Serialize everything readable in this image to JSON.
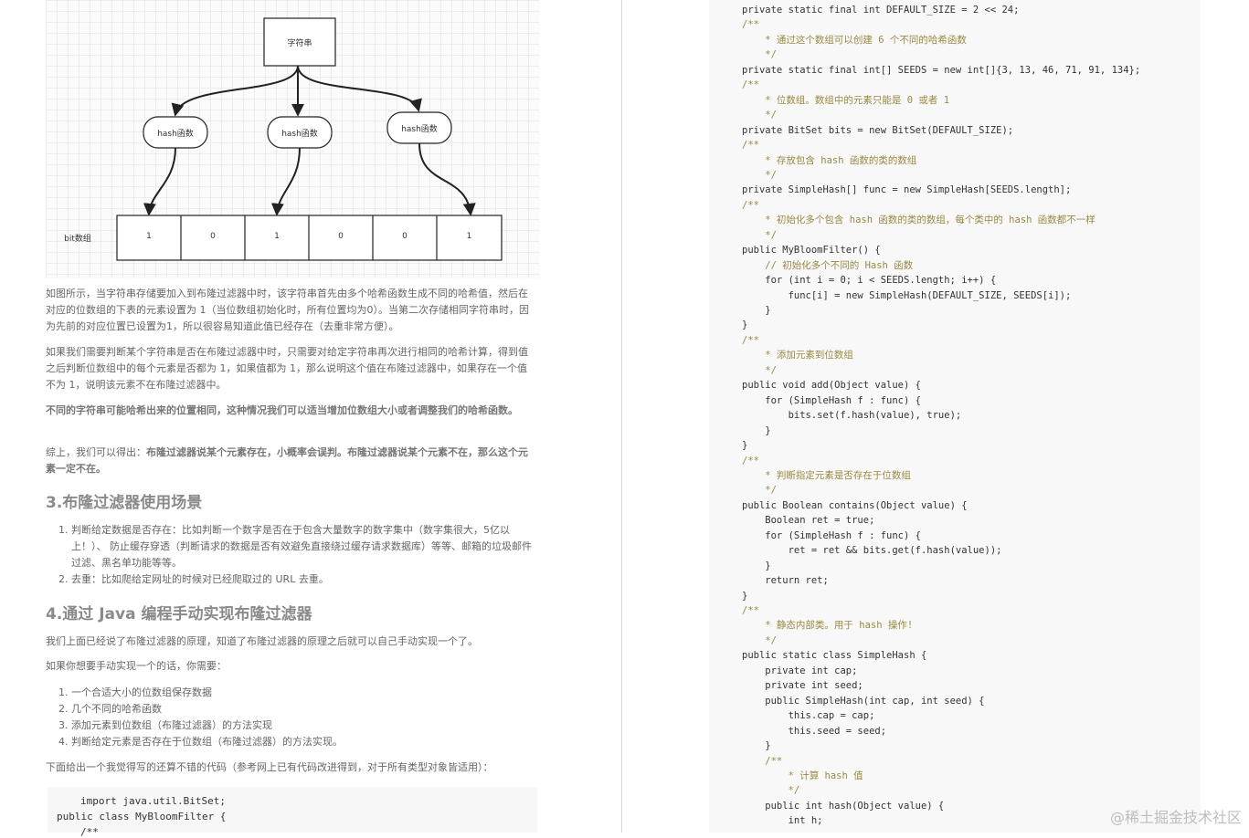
{
  "diagram": {
    "top_box": "字符串",
    "hash_nodes": [
      "hash函数",
      "hash函数",
      "hash函数"
    ],
    "array_label": "bit数组",
    "array_values": [
      "1",
      "0",
      "1",
      "0",
      "0",
      "1"
    ]
  },
  "article": {
    "p1": "如图所示，当字符串存储要加入到布隆过滤器中时，该字符串首先由多个哈希函数生成不同的哈希值，然后在对应的位数组的下表的元素设置为 1（当位数组初始化时，所有位置均为0）。当第二次存储相同字符串时，因为先前的对应位置已设置为1，所以很容易知道此值已经存在（去重非常方便）。",
    "p2": "如果我们需要判断某个字符串是否在布隆过滤器中时，只需要对给定字符串再次进行相同的哈希计算，得到值之后判断位数组中的每个元素是否都为 1，如果值都为 1，那么说明这个值在布隆过滤器中，如果存在一个值不为 1，说明该元素不在布隆过滤器中。",
    "p3_bold": "不同的字符串可能哈希出来的位置相同，这种情况我们可以适当增加位数组大小或者调整我们的哈希函数。",
    "p4_prefix": "综上，我们可以得出：",
    "p4_bold": "布隆过滤器说某个元素存在，小概率会误判。布隆过滤器说某个元素不在，那么这个元素一定不在。",
    "h3_1": "3.布隆过滤器使用场景",
    "list1": [
      {
        "num": "1.",
        "text": "判断给定数据是否存在：比如判断一个数字是否在于包含大量数字的数字集中（数字集很大，5亿以上！）、 防止缓存穿透（判断请求的数据是否有效避免直接绕过缓存请求数据库）等等、邮箱的垃圾邮件过滤、黑名单功能等等。"
      },
      {
        "num": "2.",
        "text": "去重：比如爬给定网址的时候对已经爬取过的 URL 去重。"
      }
    ],
    "h3_2": "4.通过 Java 编程手动实现布隆过滤器",
    "p5": "我们上面已经说了布隆过滤器的原理，知道了布隆过滤器的原理之后就可以自己手动实现一个了。",
    "p6": "如果你想要手动实现一个的话，你需要：",
    "list2": [
      {
        "num": "1.",
        "text": "一个合适大小的位数组保存数据"
      },
      {
        "num": "2.",
        "text": "几个不同的哈希函数"
      },
      {
        "num": "3.",
        "text": "添加元素到位数组（布隆过滤器）的方法实现"
      },
      {
        "num": "4.",
        "text": "判断给定元素是否存在于位数组（布隆过滤器）的方法实现。"
      }
    ],
    "p7": "下面给出一个我觉得写的还算不错的代码（参考网上已有代码改进得到，对于所有类型对象皆适用）：",
    "code_l1": "import java.util.BitSet;",
    "code_l2": "public class MyBloomFilter {",
    "code_l3": "/**"
  },
  "code": [
    "private static final int DEFAULT_SIZE = 2 << 24;",
    "/**",
    "    * 通过这个数组可以创建 6 个不同的哈希函数",
    "    */",
    "private static final int[] SEEDS = new int[]{3, 13, 46, 71, 91, 134};",
    "/**",
    "    * 位数组。数组中的元素只能是 0 或者 1",
    "    */",
    "private BitSet bits = new BitSet(DEFAULT_SIZE);",
    "/**",
    "    * 存放包含 hash 函数的类的数组",
    "    */",
    "private SimpleHash[] func = new SimpleHash[SEEDS.length];",
    "/**",
    "    * 初始化多个包含 hash 函数的类的数组，每个类中的 hash 函数都不一样",
    "    */",
    "public MyBloomFilter() {",
    "    // 初始化多个不同的 Hash 函数",
    "    for (int i = 0; i < SEEDS.length; i++) {",
    "        func[i] = new SimpleHash(DEFAULT_SIZE, SEEDS[i]);",
    "    }",
    "}",
    "/**",
    "    * 添加元素到位数组",
    "    */",
    "public void add(Object value) {",
    "    for (SimpleHash f : func) {",
    "        bits.set(f.hash(value), true);",
    "    }",
    "}",
    "/**",
    "    * 判断指定元素是否存在于位数组",
    "    */",
    "public Boolean contains(Object value) {",
    "    Boolean ret = true;",
    "    for (SimpleHash f : func) {",
    "        ret = ret && bits.get(f.hash(value));",
    "    }",
    "    return ret;",
    "}",
    "/**",
    "    * 静态内部类。用于 hash 操作!",
    "    */",
    "public static class SimpleHash {",
    "    private int cap;",
    "    private int seed;",
    "    public SimpleHash(int cap, int seed) {",
    "        this.cap = cap;",
    "        this.seed = seed;",
    "    }",
    "    /**",
    "        * 计算 hash 值",
    "        */",
    "    public int hash(Object value) {",
    "        int h;"
  ],
  "watermark": "@稀土掘金技术社区"
}
